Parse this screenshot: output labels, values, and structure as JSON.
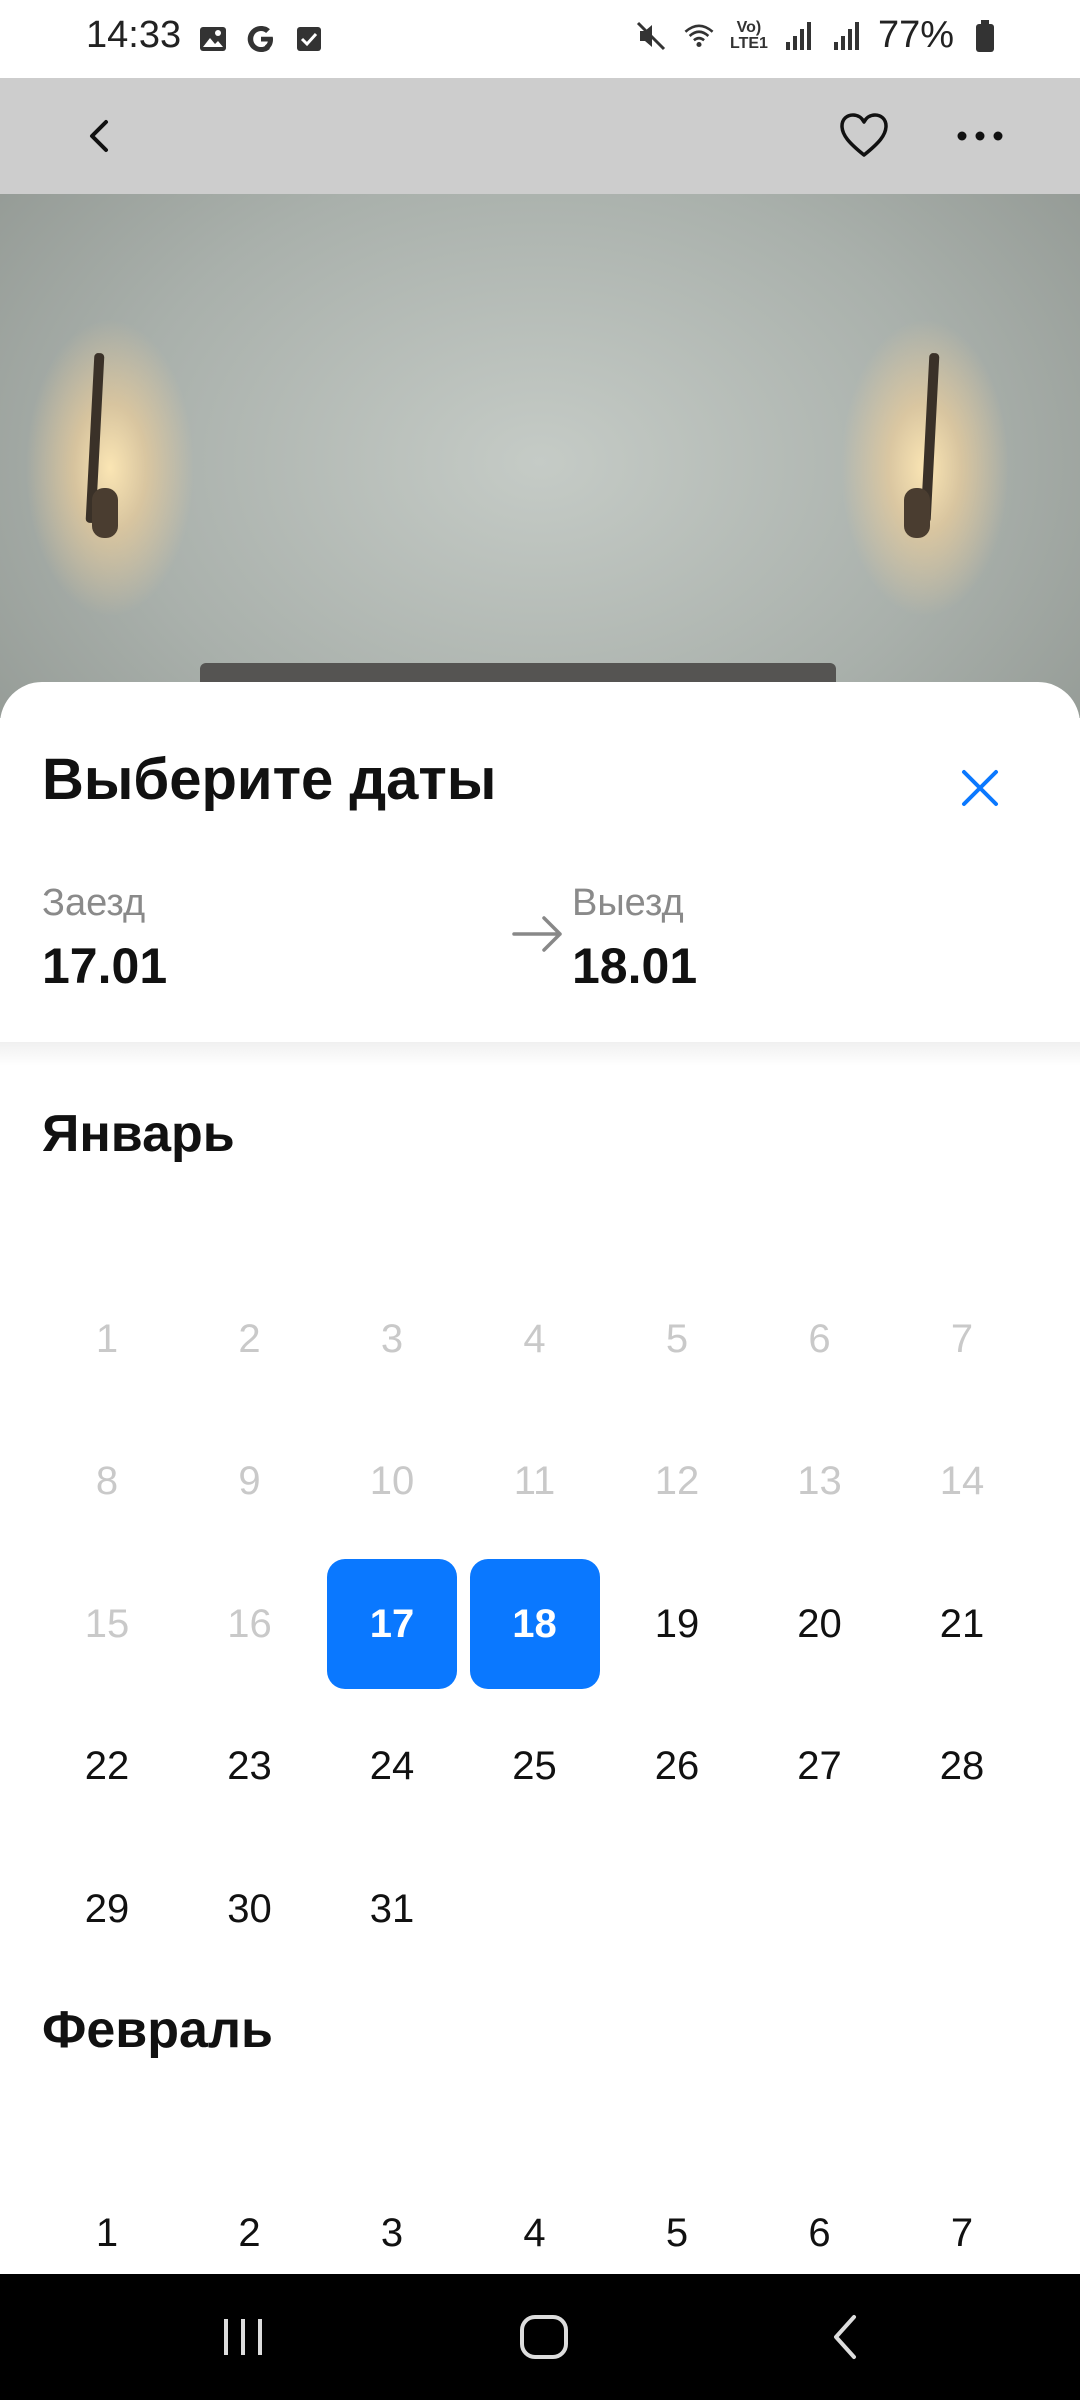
{
  "status_bar": {
    "time": "14:33",
    "battery_percent": "77%",
    "network_label_top": "Vo)",
    "network_label_bottom": "LTE1",
    "left_icons": [
      "gallery-icon",
      "google-icon",
      "checkbox-icon"
    ],
    "right_icons": [
      "mute-icon",
      "wifi-icon",
      "signal-icon",
      "signal-icon",
      "battery-icon"
    ]
  },
  "header": {
    "back_icon": "chevron-left-icon",
    "favorite_icon": "heart-icon",
    "more_icon": "more-horizontal-icon"
  },
  "sheet": {
    "title": "Выберите даты",
    "close_icon": "close-icon",
    "checkin": {
      "label": "Заезд",
      "value": "17.01"
    },
    "checkout": {
      "label": "Выезд",
      "value": "18.01"
    },
    "arrow_icon": "arrow-right-icon"
  },
  "calendar": {
    "months": [
      {
        "name": "Январь",
        "first_weekday_index": 0,
        "days": [
          "1",
          "2",
          "3",
          "4",
          "5",
          "6",
          "7",
          "8",
          "9",
          "10",
          "11",
          "12",
          "13",
          "14",
          "15",
          "16",
          "17",
          "18",
          "19",
          "20",
          "21",
          "22",
          "23",
          "24",
          "25",
          "26",
          "27",
          "28",
          "29",
          "30",
          "31"
        ],
        "disabled_through_day": 16,
        "selected_days": [
          "17",
          "18"
        ]
      },
      {
        "name": "Февраль",
        "first_weekday_index": 0,
        "days": [
          "1",
          "2",
          "3",
          "4",
          "5",
          "6",
          "7"
        ],
        "disabled_through_day": 0,
        "selected_days": []
      }
    ],
    "accent_color": "#0a78ff"
  },
  "nav_bar": {
    "icons": [
      "recent-apps-icon",
      "home-icon",
      "back-icon"
    ]
  }
}
